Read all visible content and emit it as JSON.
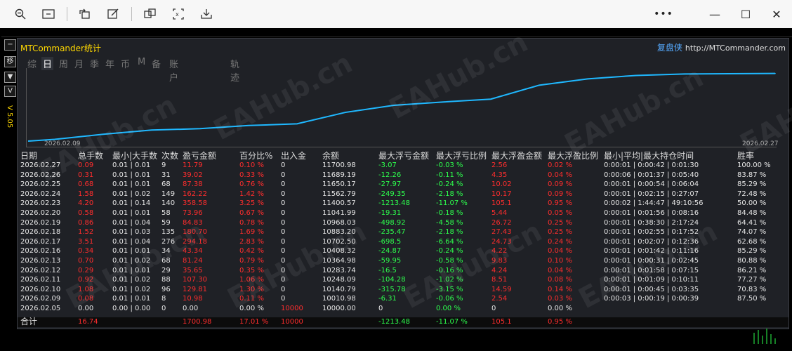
{
  "toolbar": {
    "icons": [
      "zoom-out-icon",
      "fit-page-icon",
      "rotate-icon",
      "edit-icon",
      "translate-icon",
      "ai-scan-icon",
      "download-icon"
    ],
    "more": "•••",
    "minimize": "—",
    "maximize": "☐",
    "close": "✕"
  },
  "sidebar": {
    "buttons": [
      "−",
      "移",
      "▼",
      "V"
    ],
    "version": "V 5.05"
  },
  "panel": {
    "title": "MTCommander统计",
    "brand": "复盘侠",
    "brand_url": "http://MTCommander.com",
    "tabs": [
      "综",
      "日",
      "周",
      "月",
      "季",
      "年",
      "币",
      "M",
      "备",
      "账户",
      "轨迹"
    ],
    "active_tab": "日"
  },
  "chart_data": {
    "type": "line",
    "x": [
      "2026.02.09",
      "2026.02.10",
      "2026.02.11",
      "2026.02.12",
      "2026.02.13",
      "2026.02.16",
      "2026.02.17",
      "2026.02.18",
      "2026.02.19",
      "2026.02.20",
      "2026.02.23",
      "2026.02.24",
      "2026.02.25",
      "2026.02.26",
      "2026.02.27"
    ],
    "values": [
      10010.98,
      10140.79,
      10248.09,
      10283.74,
      10364.98,
      10408.32,
      10702.5,
      10883.2,
      10968.03,
      11041.99,
      11400.57,
      11562.79,
      11650.17,
      11689.19,
      11700.98
    ],
    "start_label": "2026.02.09",
    "end_label": "2026.02.27",
    "line_color": "#1fb8ff"
  },
  "table": {
    "headers": [
      "日期",
      "总手数",
      "最小|大手数",
      "次数",
      "盈亏金额",
      "百分比%",
      "出入金",
      "余额",
      "最大浮亏金额",
      "最大浮亏比例",
      "最大浮盈金额",
      "最大浮盈比例",
      "最小|平均|最大持仓时间",
      "胜率"
    ],
    "rows": [
      [
        "2026.02.27",
        "0.09",
        "0.01 | 0.01",
        "9",
        "11.79",
        "0.10 %",
        "0",
        "11700.98",
        "-3.07",
        "-0.03 %",
        "2.56",
        "0.02 %",
        "0:00:01 | 0:00:42 | 0:01:30",
        "100.00 %"
      ],
      [
        "2026.02.26",
        "0.31",
        "0.01 | 0.01",
        "31",
        "39.02",
        "0.33 %",
        "0",
        "11689.19",
        "-12.26",
        "-0.11 %",
        "4.35",
        "0.04 %",
        "0:00:06 | 0:01:37 | 0:05:40",
        "83.87 %"
      ],
      [
        "2026.02.25",
        "0.68",
        "0.01 | 0.01",
        "68",
        "87.38",
        "0.76 %",
        "0",
        "11650.17",
        "-27.97",
        "-0.24 %",
        "10.02",
        "0.09 %",
        "0:00:01 | 0:00:54 | 0:06:04",
        "85.29 %"
      ],
      [
        "2026.02.24",
        "1.58",
        "0.01 | 0.02",
        "149",
        "162.22",
        "1.42 %",
        "0",
        "11562.79",
        "-249.35",
        "-2.18 %",
        "10.17",
        "0.09 %",
        "0:00:01 | 0:02:15 | 0:27:07",
        "72.48 %"
      ],
      [
        "2026.02.23",
        "4.20",
        "0.01 | 0.14",
        "140",
        "358.58",
        "3.25 %",
        "0",
        "11400.57",
        "-1213.48",
        "-11.07 %",
        "105.1",
        "0.95 %",
        "0:00:02 | 1:44:47 | 49:10:56",
        "50.00 %"
      ],
      [
        "2026.02.20",
        "0.58",
        "0.01 | 0.01",
        "58",
        "73.96",
        "0.67 %",
        "0",
        "11041.99",
        "-19.31",
        "-0.18 %",
        "5.44",
        "0.05 %",
        "0:00:01 | 0:01:56 | 0:08:16",
        "84.48 %"
      ],
      [
        "2026.02.19",
        "0.86",
        "0.01 | 0.04",
        "59",
        "84.83",
        "0.78 %",
        "0",
        "10968.03",
        "-498.92",
        "-4.58 %",
        "26.72",
        "0.25 %",
        "0:00:01 | 0:38:30 | 2:17:24",
        "64.41 %"
      ],
      [
        "2026.02.18",
        "1.52",
        "0.01 | 0.03",
        "135",
        "180.70",
        "1.69 %",
        "0",
        "10883.20",
        "-235.47",
        "-2.18 %",
        "27.43",
        "0.25 %",
        "0:00:01 | 0:02:55 | 0:17:52",
        "74.07 %"
      ],
      [
        "2026.02.17",
        "3.51",
        "0.01 | 0.04",
        "276",
        "294.18",
        "2.83 %",
        "0",
        "10702.50",
        "-698.5",
        "-6.64 %",
        "24.73",
        "0.24 %",
        "0:00:01 | 0:02:07 | 0:12:36",
        "62.68 %"
      ],
      [
        "2026.02.16",
        "0.34",
        "0.01 | 0.01",
        "34",
        "43.34",
        "0.42 %",
        "0",
        "10408.32",
        "-24.87",
        "-0.24 %",
        "4.22",
        "0.04 %",
        "0:00:01 | 0:01:42 | 0:11:16",
        "85.29 %"
      ],
      [
        "2026.02.13",
        "0.70",
        "0.01 | 0.02",
        "68",
        "81.24",
        "0.79 %",
        "0",
        "10364.98",
        "-59.95",
        "-0.58 %",
        "9.83",
        "0.10 %",
        "0:00:01 | 0:00:31 | 0:02:45",
        "80.88 %"
      ],
      [
        "2026.02.12",
        "0.29",
        "0.01 | 0.01",
        "29",
        "35.65",
        "0.35 %",
        "0",
        "10283.74",
        "-16.5",
        "-0.16 %",
        "4.24",
        "0.04 %",
        "0:00:01 | 0:01:58 | 0:07:15",
        "86.21 %"
      ],
      [
        "2026.02.11",
        "0.92",
        "0.01 | 0.02",
        "88",
        "107.30",
        "1.06 %",
        "0",
        "10248.09",
        "-104.28",
        "-1.02 %",
        "8.51",
        "0.08 %",
        "0:00:01 | 0:01:09 | 0:10:11",
        "77.27 %"
      ],
      [
        "2026.02.10",
        "1.08",
        "0.01 | 0.02",
        "96",
        "129.81",
        "1.30 %",
        "0",
        "10140.79",
        "-315.78",
        "-3.15 %",
        "14.59",
        "0.14 %",
        "0:00:01 | 0:00:45 | 0:03:35",
        "70.83 %"
      ],
      [
        "2026.02.09",
        "0.08",
        "0.01 | 0.01",
        "8",
        "10.98",
        "0.11 %",
        "0",
        "10010.98",
        "-6.31",
        "-0.06 %",
        "2.54",
        "0.03 %",
        "0:00:03 | 0:00:19 | 0:00:39",
        "87.50 %"
      ],
      [
        "2026.02.05",
        "0.00",
        "0.00 | 0.00",
        "0",
        "0.00",
        "0.00 %",
        "10000",
        "10000.00",
        "0",
        "0.00 %",
        "0",
        "0.00 %",
        "",
        ""
      ]
    ],
    "total": {
      "label": "合计",
      "lots": "16.74",
      "pnl": "1700.98",
      "pct": "17.01 %",
      "deposit": "10000",
      "max_float_loss": "-1213.48",
      "max_float_loss_pct": "-11.07 %",
      "max_float_profit": "105.1",
      "max_float_profit_pct": "0.95 %"
    }
  },
  "watermark": "EAHub.cn"
}
